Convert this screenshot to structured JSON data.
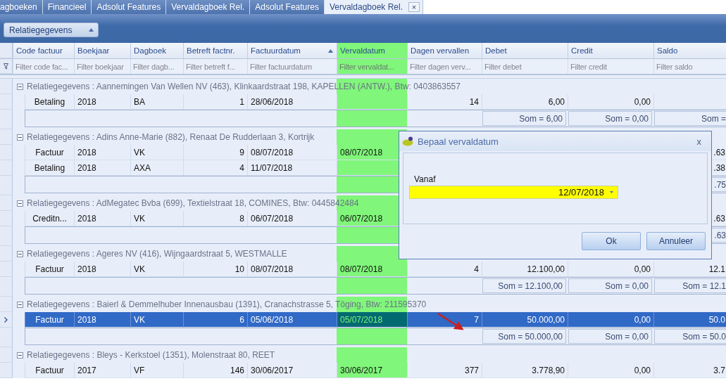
{
  "tabs": [
    {
      "label": "agboeken",
      "selected": false
    },
    {
      "label": "Financieel",
      "selected": false
    },
    {
      "label": "Adsolut Features",
      "selected": false
    },
    {
      "label": "Vervaldagboek Rel.",
      "selected": false
    },
    {
      "label": "Adsolut Features",
      "selected": false
    },
    {
      "label": "Vervaldagboek Rel.",
      "selected": true,
      "close": "×"
    }
  ],
  "group_panel": {
    "button": "Relatiegegevens"
  },
  "grid": {
    "columns": [
      {
        "label": "Code factuur",
        "filter": "Filter code fac...",
        "kind": "text",
        "highlighted": false,
        "sorted": false
      },
      {
        "label": "Boekjaar",
        "filter": "Filter boekjaar",
        "kind": "text",
        "highlighted": false,
        "sorted": false
      },
      {
        "label": "Dagboek",
        "filter": "Filter dagb...",
        "kind": "text",
        "highlighted": false,
        "sorted": false
      },
      {
        "label": "Betreft factnr.",
        "filter": "Filter betreft f...",
        "kind": "number",
        "highlighted": false,
        "sorted": false
      },
      {
        "label": "Factuurdatum",
        "filter": "Filter factuurdatum",
        "kind": "text",
        "highlighted": false,
        "sorted": true
      },
      {
        "label": "Vervaldatum",
        "filter": "Filter vervaldat...",
        "kind": "text",
        "highlighted": true,
        "sorted": false
      },
      {
        "label": "Dagen vervallen",
        "filter": "Filter dagen verv...",
        "kind": "number",
        "highlighted": false,
        "sorted": false
      },
      {
        "label": "Debet",
        "filter": "Filter debet",
        "kind": "number",
        "highlighted": false,
        "sorted": false
      },
      {
        "label": "Credit",
        "filter": "Filter credit",
        "kind": "number",
        "highlighted": false,
        "sorted": false
      },
      {
        "label": "Saldo",
        "filter": "Filter saldo",
        "kind": "number",
        "highlighted": false,
        "sorted": false
      }
    ],
    "groups": [
      {
        "title": "Relatiegegevens : Aannemingen Van Wellen NV (463), Klinkaardstraat 198, KAPELLEN (ANTW.), Btw: 0403863557",
        "expanded": true,
        "rows": [
          {
            "selected": false,
            "code_factuur": "Betaling",
            "boekjaar": "2018",
            "dagboek": "BA",
            "betreft_factnr": "1",
            "factuurdatum": "28/06/2018",
            "dagen_vervallen": "14",
            "debet": "6,00",
            "credit": "0,00"
          }
        ],
        "summary": {
          "debet": "Som = 6,00",
          "credit": "Som = 0,00",
          "saldo": "Som ="
        }
      },
      {
        "title": "Relatiegegevens : Adins Anne-Marie (882), Renaat De Rudderlaan 3, Kortrijk",
        "expanded": true,
        "rows": [
          {
            "selected": false,
            "code_factuur": "Factuur",
            "boekjaar": "2018",
            "dagboek": "VK",
            "betreft_factnr": "9",
            "factuurdatum": "08/07/2018",
            "vervaldatum": "08/07/2018",
            "saldo": ".63"
          },
          {
            "selected": false,
            "code_factuur": "Betaling",
            "boekjaar": "2018",
            "dagboek": "AXA",
            "betreft_factnr": "4",
            "factuurdatum": "11/07/2018",
            "saldo": ".38"
          }
        ],
        "summary": {
          "saldo": ".75"
        }
      },
      {
        "title": "Relatiegegevens : AdMegatec Bvba (699), Textielstraat 18, COMINES, Btw: 0445842484",
        "expanded": true,
        "rows": [
          {
            "selected": false,
            "code_factuur": "Creditn...",
            "boekjaar": "2018",
            "dagboek": "VK",
            "betreft_factnr": "8",
            "factuurdatum": "06/07/2018",
            "vervaldatum": "06/07/2018",
            "saldo": ".63"
          }
        ],
        "summary": {
          "saldo": ".63"
        }
      },
      {
        "title": "Relatiegegevens : Ageres NV (416), Wijngaardstraat 5, WESTMALLE",
        "expanded": true,
        "rows": [
          {
            "selected": false,
            "code_factuur": "Factuur",
            "boekjaar": "2018",
            "dagboek": "VK",
            "betreft_factnr": "10",
            "factuurdatum": "08/07/2018",
            "vervaldatum": "08/07/2018",
            "dagen_vervallen": "4",
            "debet": "12.100,00",
            "credit": "0,00",
            "saldo": "12.1"
          }
        ],
        "summary": {
          "debet": "Som = 12.100,00",
          "credit": "Som = 0,00",
          "saldo": "Som = 12.1"
        }
      },
      {
        "title": "Relatiegegevens : Baierl & Demmelhuber Innenausbau (1391), Cranachstrasse 5, Töging, Btw: 211595370",
        "expanded": true,
        "rows": [
          {
            "selected": true,
            "code_factuur": "Factuur",
            "boekjaar": "2018",
            "dagboek": "VK",
            "betreft_factnr": "6",
            "factuurdatum": "05/06/2018",
            "vervaldatum": "05/07/2018",
            "dagen_vervallen": "7",
            "debet": "50.000,00",
            "credit": "0,00",
            "saldo": "50.0"
          }
        ],
        "summary": {
          "debet": "Som = 50.000,00",
          "credit": "Som = 0,00",
          "saldo": "Som = 50.0"
        }
      },
      {
        "title": "Relatiegegevens : Bleys - Kerkstoel (1351), Molenstraat 80, REET",
        "expanded": true,
        "rows": [
          {
            "selected": false,
            "code_factuur": "Factuur",
            "boekjaar": "2017",
            "dagboek": "VF",
            "betreft_factnr": "146",
            "factuurdatum": "30/06/2017",
            "vervaldatum": "30/06/2017",
            "dagen_vervallen": "377",
            "debet": "3.778,90",
            "credit": "0,00",
            "saldo": "3.7"
          }
        ]
      }
    ]
  },
  "dialog": {
    "title": "Bepaal vervaldatum",
    "close": "x",
    "field_label": "Vanaf",
    "field_value": "12/07/2018",
    "buttons": [
      "Ok",
      "Annuleer"
    ]
  }
}
